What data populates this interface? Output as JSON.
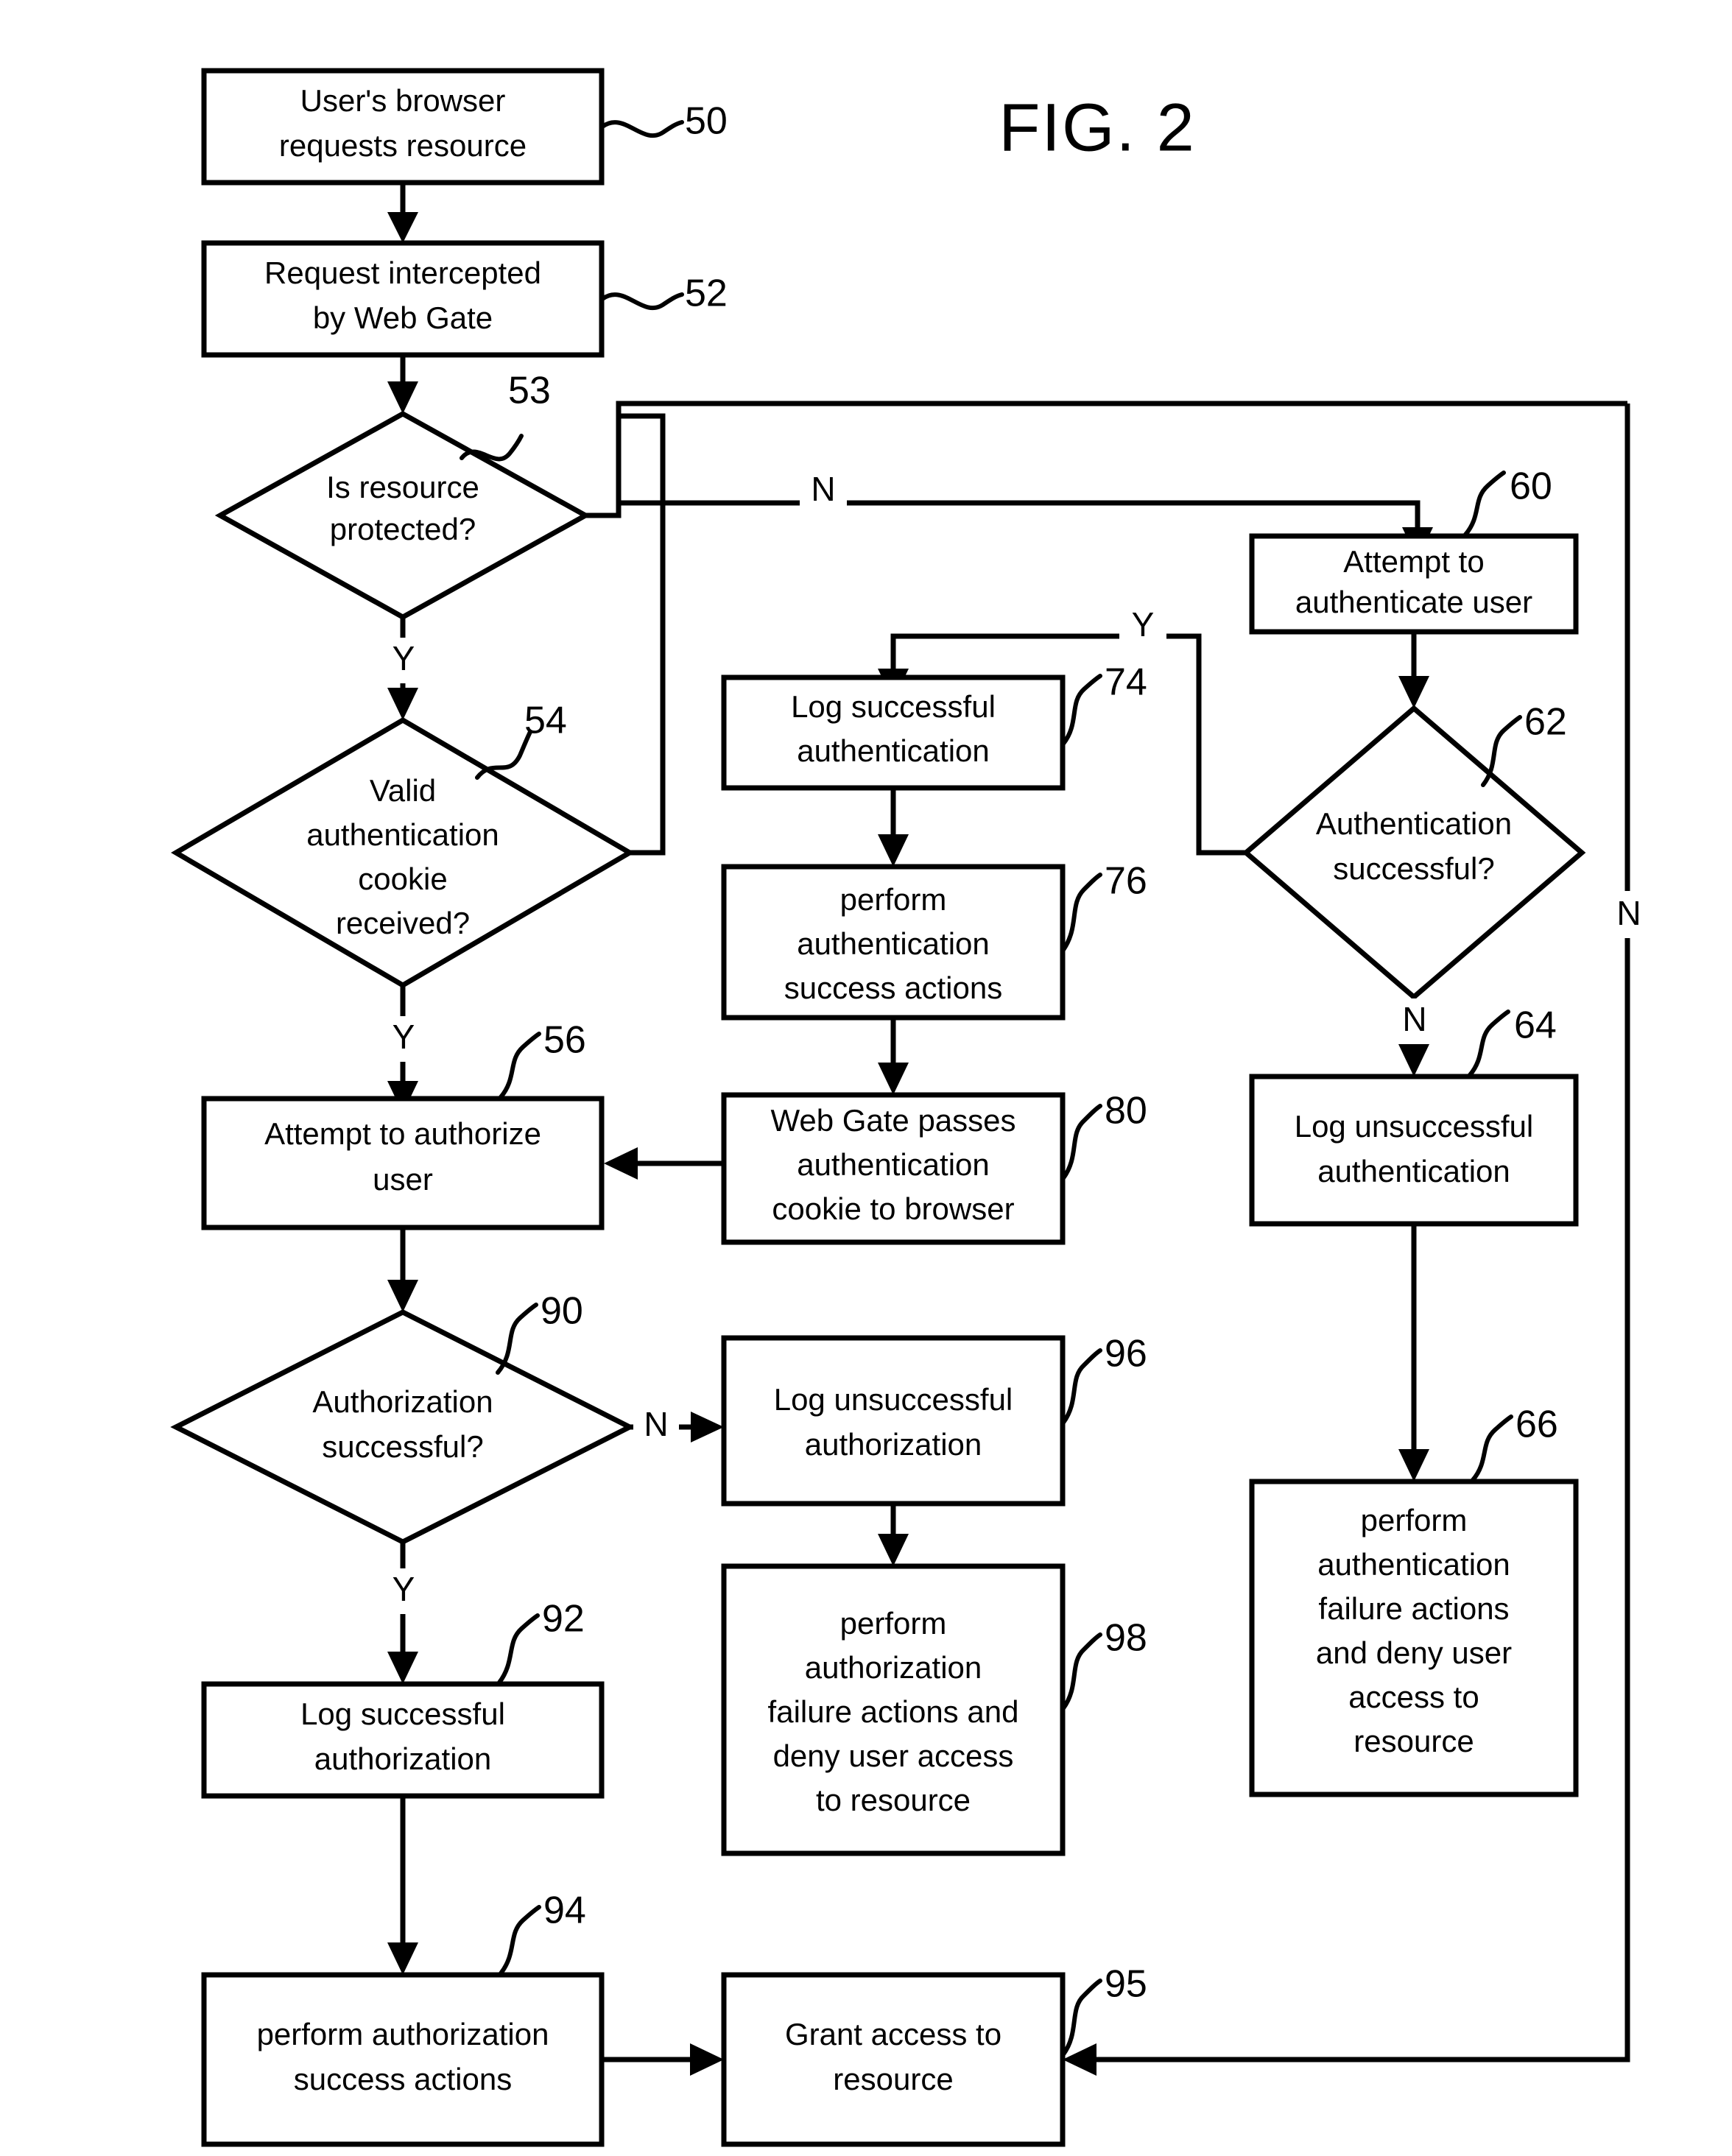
{
  "figure": {
    "title": "FIG. 2",
    "type": "patent-flowchart"
  },
  "nodes": {
    "n50": {
      "ref": "50",
      "shape": "process",
      "lines": [
        "User's browser",
        "requests resource"
      ]
    },
    "n52": {
      "ref": "52",
      "shape": "process",
      "lines": [
        "Request intercepted",
        "by Web Gate"
      ]
    },
    "n53": {
      "ref": "53",
      "shape": "decision",
      "lines": [
        "Is resource",
        "protected?"
      ]
    },
    "n54": {
      "ref": "54",
      "shape": "decision",
      "lines": [
        "Valid",
        "authentication",
        "cookie",
        "received?"
      ]
    },
    "n56": {
      "ref": "56",
      "shape": "process",
      "lines": [
        "Attempt to authorize",
        "user"
      ]
    },
    "n60": {
      "ref": "60",
      "shape": "process",
      "lines": [
        "Attempt to",
        "authenticate user"
      ]
    },
    "n62": {
      "ref": "62",
      "shape": "decision",
      "lines": [
        "Authentication",
        "successful?"
      ]
    },
    "n64": {
      "ref": "64",
      "shape": "process",
      "lines": [
        "Log unsuccessful",
        "authentication"
      ]
    },
    "n66": {
      "ref": "66",
      "shape": "process",
      "lines": [
        "perform",
        "authentication",
        "failure actions",
        "and deny user",
        "access  to",
        "resource"
      ]
    },
    "n74": {
      "ref": "74",
      "shape": "process",
      "lines": [
        "Log successful",
        "authentication"
      ]
    },
    "n76": {
      "ref": "76",
      "shape": "process",
      "lines": [
        "perform",
        "authentication",
        "success actions"
      ]
    },
    "n80": {
      "ref": "80",
      "shape": "process",
      "lines": [
        "Web Gate passes",
        "authentication",
        "cookie to browser"
      ]
    },
    "n90": {
      "ref": "90",
      "shape": "decision",
      "lines": [
        "Authorization",
        "successful?"
      ]
    },
    "n92": {
      "ref": "92",
      "shape": "process",
      "lines": [
        "Log successful",
        "authorization"
      ]
    },
    "n94": {
      "ref": "94",
      "shape": "process",
      "lines": [
        "perform authorization",
        "success actions"
      ]
    },
    "n95": {
      "ref": "95",
      "shape": "process",
      "lines": [
        "Grant access to",
        "resource"
      ]
    },
    "n96": {
      "ref": "96",
      "shape": "process",
      "lines": [
        "Log unsuccessful",
        "authorization"
      ]
    },
    "n98": {
      "ref": "98",
      "shape": "process",
      "lines": [
        "perform",
        "authorization",
        "failure actions and",
        "deny user access",
        "to resource"
      ]
    }
  },
  "branch_labels": {
    "protected_no": "N",
    "protected_yes": "Y",
    "cookie_yes": "Y",
    "auth_yes": "Y",
    "auth_no": "N",
    "auth_no_right": "N",
    "authz_no": "N",
    "authz_yes": "Y"
  },
  "colors": {
    "stroke": "#000000",
    "fill": "#ffffff"
  }
}
